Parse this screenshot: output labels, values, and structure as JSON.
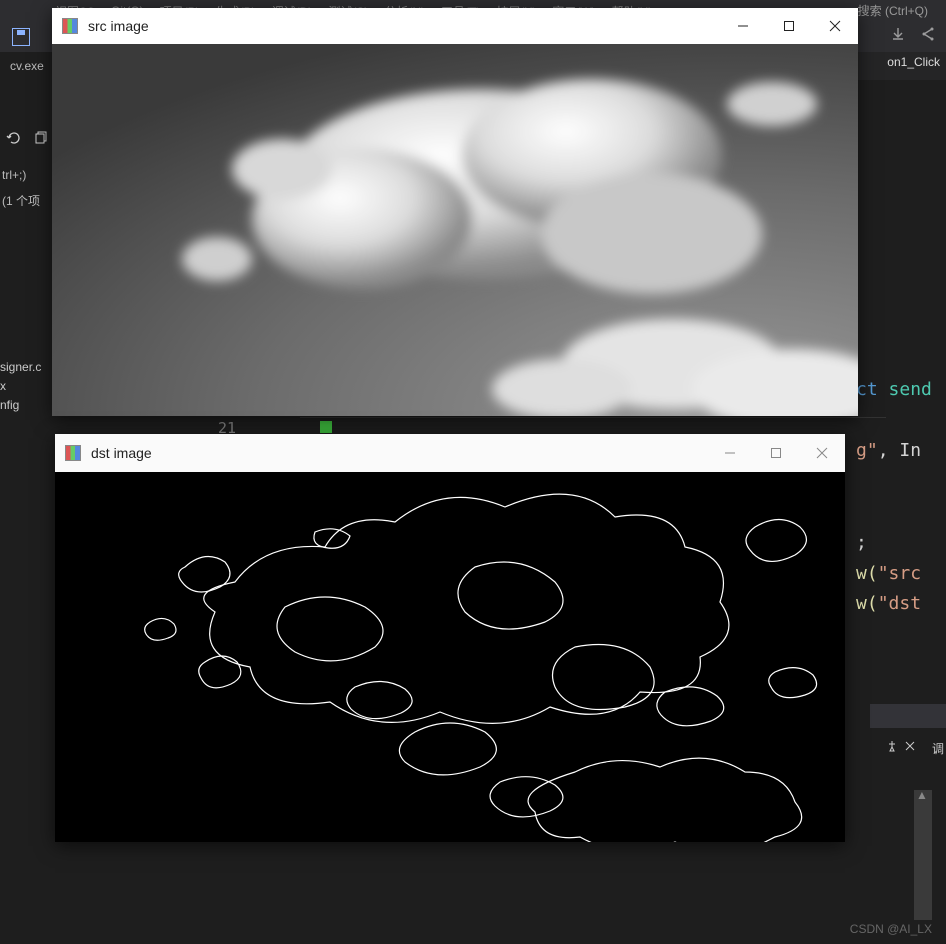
{
  "menu": {
    "items": [
      "视图(V)",
      "Git(G)",
      "项目(P)",
      "生成(B)",
      "调试(D)",
      "测试(S)",
      "分析(N)",
      "工具(T)",
      "扩展(X)",
      "窗口(W)",
      "帮助(H)"
    ]
  },
  "search": {
    "hint": "搜索 (Ctrl+Q)"
  },
  "tabs": {
    "main": "cv.exe",
    "right": "on1_Click"
  },
  "left": {
    "shortcut": "trl+;)",
    "count": "(1 个项",
    "files": [
      "signer.c",
      "x",
      "nfig"
    ]
  },
  "code": {
    "line21": "21",
    "frag_ct": "ct ",
    "frag_send": "send",
    "frag_g": "g\"",
    "frag_comma_in": ", In",
    "frag_semi": ";",
    "frag_w1": "w(",
    "frag_src": "\"src",
    "frag_w2": "w(",
    "frag_dst": "\"dst"
  },
  "windows": {
    "src": {
      "title": "src image"
    },
    "dst": {
      "title": "dst image"
    }
  },
  "bottom": {
    "err": "调"
  },
  "watermark": "CSDN @AI_LX"
}
